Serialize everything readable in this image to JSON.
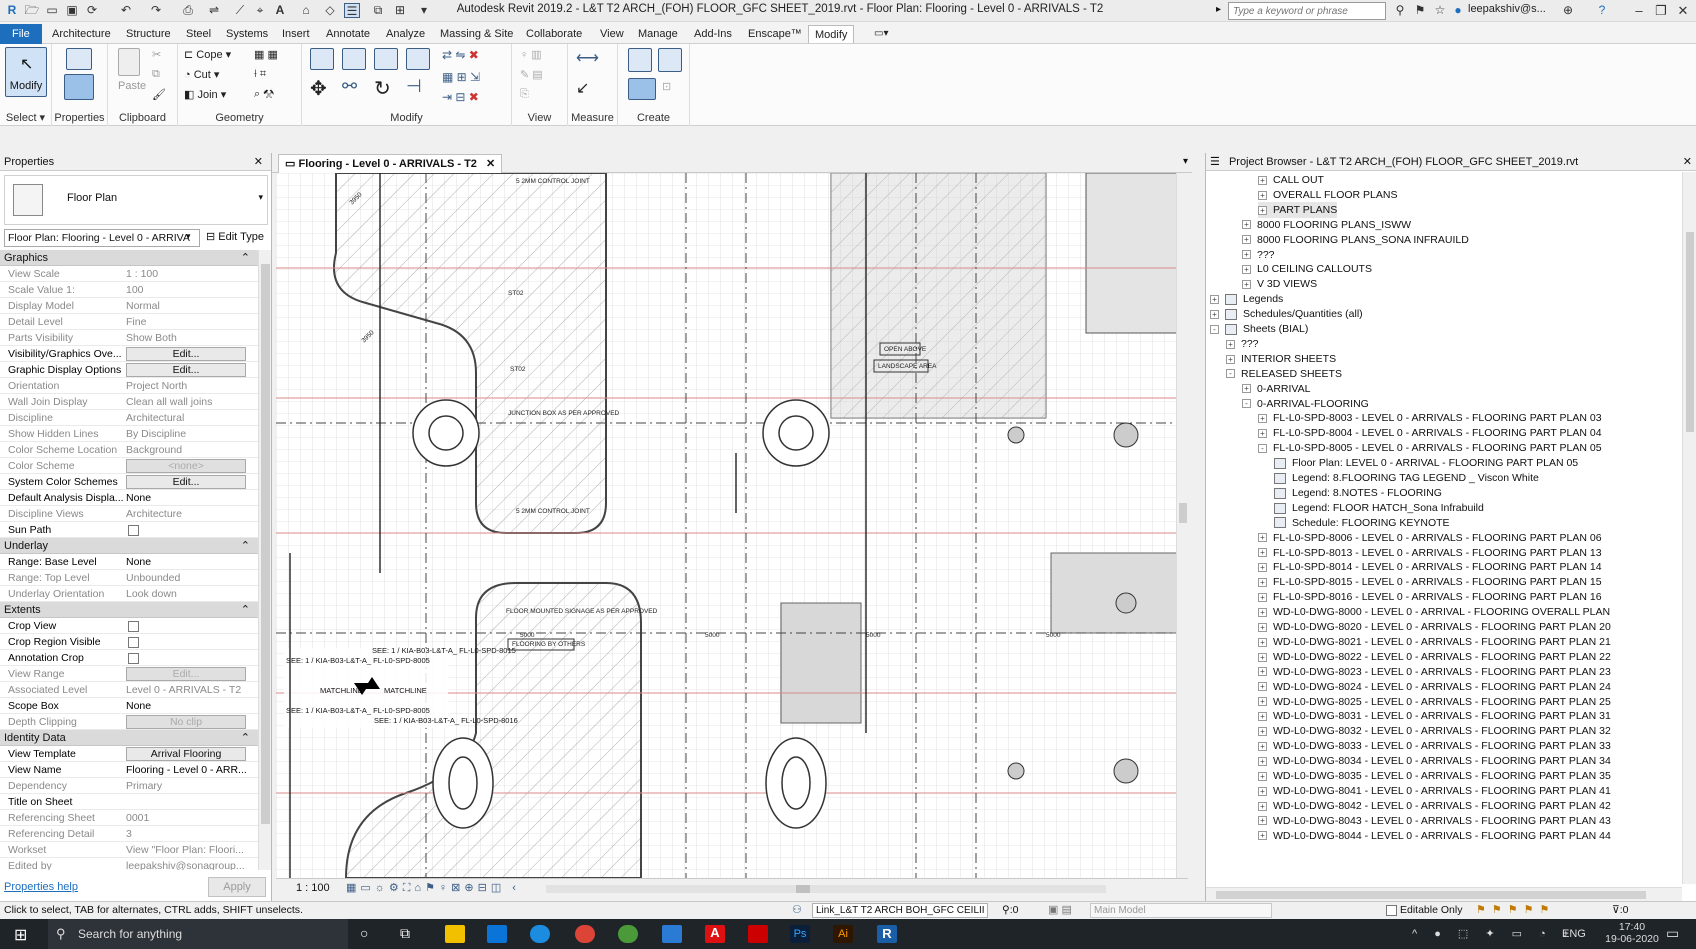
{
  "app": {
    "title": "Autodesk Revit 2019.2 - L&T T2 ARCH_(FOH) FLOOR_GFC SHEET_2019.rvt - Floor Plan: Flooring - Level 0 - ARRIVALS - T2",
    "search_placeholder": "Type a keyword or phrase",
    "user": "leepakshiv@s...",
    "logo": "R"
  },
  "ribbon_tabs": [
    "File",
    "Architecture",
    "Structure",
    "Steel",
    "Systems",
    "Insert",
    "Annotate",
    "Analyze",
    "Massing & Site",
    "Collaborate",
    "View",
    "Manage",
    "Add-Ins",
    "Enscape™",
    "Modify"
  ],
  "ribbon": {
    "modify_label": "Modify",
    "select_label": "Select",
    "properties_label": "Properties",
    "clipboard_label": "Clipboard",
    "paste_label": "Paste",
    "geometry_label": "Geometry",
    "cope_label": "Cope",
    "cut_label": "Cut",
    "join_label": "Join",
    "modify_panel_label": "Modify",
    "view_label": "View",
    "measure_label": "Measure",
    "create_label": "Create"
  },
  "properties": {
    "header": "Properties",
    "type_name": "Floor Plan",
    "selector": "Floor Plan: Flooring - Level 0 - ARRIVA",
    "edit_type": "Edit Type",
    "help_link": "Properties help",
    "apply": "Apply",
    "groups": {
      "graphics": "Graphics",
      "underlay": "Underlay",
      "extents": "Extents",
      "identity": "Identity Data"
    },
    "rows": [
      {
        "k": "View Scale",
        "v": "1 : 100",
        "dim": true
      },
      {
        "k": "Scale Value    1:",
        "v": "100",
        "dim": true
      },
      {
        "k": "Display Model",
        "v": "Normal",
        "dim": true
      },
      {
        "k": "Detail Level",
        "v": "Fine",
        "dim": true
      },
      {
        "k": "Parts Visibility",
        "v": "Show Both",
        "dim": true
      },
      {
        "k": "Visibility/Graphics Ove...",
        "v": "Edit...",
        "btn": true
      },
      {
        "k": "Graphic Display Options",
        "v": "Edit...",
        "btn": true
      },
      {
        "k": "Orientation",
        "v": "Project North",
        "dim": true
      },
      {
        "k": "Wall Join Display",
        "v": "Clean all wall joins",
        "dim": true
      },
      {
        "k": "Discipline",
        "v": "Architectural",
        "dim": true
      },
      {
        "k": "Show Hidden Lines",
        "v": "By Discipline",
        "dim": true
      },
      {
        "k": "Color Scheme Location",
        "v": "Background",
        "dim": true
      },
      {
        "k": "Color Scheme",
        "v": "<none>",
        "dim": true,
        "btn": true
      },
      {
        "k": "System Color Schemes",
        "v": "Edit...",
        "btn": true
      },
      {
        "k": "Default Analysis Displa...",
        "v": "None"
      },
      {
        "k": "Discipline Views",
        "v": "Architecture",
        "dim": true
      },
      {
        "k": "Sun Path",
        "v": "",
        "cb": true
      }
    ],
    "underlay_rows": [
      {
        "k": "Range: Base Level",
        "v": "None"
      },
      {
        "k": "Range: Top Level",
        "v": "Unbounded",
        "dim": true
      },
      {
        "k": "Underlay Orientation",
        "v": "Look down",
        "dim": true
      }
    ],
    "extents_rows": [
      {
        "k": "Crop View",
        "v": "",
        "cb": true
      },
      {
        "k": "Crop Region Visible",
        "v": "",
        "cb": true
      },
      {
        "k": "Annotation Crop",
        "v": "",
        "cb": true
      },
      {
        "k": "View Range",
        "v": "Edit...",
        "dim": true,
        "btn": true
      },
      {
        "k": "Associated Level",
        "v": "Level 0 - ARRIVALS - T2",
        "dim": true
      },
      {
        "k": "Scope Box",
        "v": "None"
      },
      {
        "k": "Depth Clipping",
        "v": "No clip",
        "dim": true,
        "btn": true
      }
    ],
    "identity_rows": [
      {
        "k": "View Template",
        "v": "Arrival Flooring",
        "btn": true
      },
      {
        "k": "View Name",
        "v": "Flooring - Level 0 - ARR..."
      },
      {
        "k": "Dependency",
        "v": "Primary",
        "dim": true
      },
      {
        "k": "Title on Sheet",
        "v": ""
      },
      {
        "k": "Referencing Sheet",
        "v": "0001",
        "dim": true
      },
      {
        "k": "Referencing Detail",
        "v": "3",
        "dim": true
      },
      {
        "k": "Workset",
        "v": "View \"Floor Plan: Floori...",
        "dim": true
      },
      {
        "k": "Edited by",
        "v": "leepakshiv@sonagroup...",
        "dim": true
      }
    ]
  },
  "view": {
    "tab_title": "Flooring - Level 0 - ARRIVALS - T2",
    "scale": "1 : 100",
    "annotations": {
      "control_joint_top": "5 2MM CONTROL JOINT",
      "control_joint_mid": "5 2MM CONTROL JOINT",
      "junction_box": "JUNCTION BOX AS PER APPROVED",
      "signage": "FLOOR MOUNTED SIGNAGE AS PER APPROVED",
      "flooring_by_others": "FLOORING BY OTHERS",
      "open_above": "OPEN ABOVE",
      "landscape": "LANDSCAPE AREA",
      "dim_1": "5000",
      "dim_2": "5000",
      "dim_3": "5000",
      "dim_4": "5000",
      "st_1": "ST02",
      "st_2": "ST02",
      "angle_1": "3950",
      "angle_2": "3950",
      "see_left": "SEE: 1 / KIA-B03-L&T-A_ FL-L0-SPD-8005",
      "see_right": "SEE: 1 / KIA-B03-L&T-A_ FL-L0-SPD-8015",
      "matchline": "MATCHLINE",
      "see_left_b": "SEE: 1 / KIA-B03-L&T-A_ FL-L0-SPD-8005",
      "see_right_b": "SEE: 1 / KIA-B03-L&T-A_ FL-L0-SPD-8016"
    }
  },
  "project_browser": {
    "header": "Project Browser - L&T T2 ARCH_(FOH) FLOOR_GFC SHEET_2019.rvt",
    "nodes": [
      {
        "label": "CALL OUT",
        "indent": 3,
        "exp": "+"
      },
      {
        "label": "OVERALL FLOOR PLANS",
        "indent": 3,
        "exp": "+"
      },
      {
        "label": "PART PLANS",
        "indent": 3,
        "exp": "+",
        "selected": true
      },
      {
        "label": "8000 FLOORING PLANS_ISWW",
        "indent": 2,
        "exp": "+"
      },
      {
        "label": "8000 FLOORING PLANS_SONA INFRAUILD",
        "indent": 2,
        "exp": "+"
      },
      {
        "label": "???",
        "indent": 2,
        "exp": "+"
      },
      {
        "label": "L0 CEILING CALLOUTS",
        "indent": 2,
        "exp": "+"
      },
      {
        "label": "V 3D VIEWS",
        "indent": 2,
        "exp": "+"
      },
      {
        "label": "Legends",
        "indent": 0,
        "exp": "+",
        "icon": true
      },
      {
        "label": "Schedules/Quantities (all)",
        "indent": 0,
        "exp": "+",
        "icon": true
      },
      {
        "label": "Sheets (BIAL)",
        "indent": 0,
        "exp": "-",
        "icon": true
      },
      {
        "label": "???",
        "indent": 1,
        "exp": "+"
      },
      {
        "label": "INTERIOR SHEETS",
        "indent": 1,
        "exp": "+"
      },
      {
        "label": "RELEASED SHEETS",
        "indent": 1,
        "exp": "-"
      },
      {
        "label": "0-ARRIVAL",
        "indent": 2,
        "exp": "+"
      },
      {
        "label": "0-ARRIVAL-FLOORING",
        "indent": 2,
        "exp": "-"
      },
      {
        "label": "FL-L0-SPD-8003 - LEVEL 0 - ARRIVALS - FLOORING PART PLAN 03",
        "indent": 3,
        "exp": "+"
      },
      {
        "label": "FL-L0-SPD-8004 - LEVEL 0 - ARRIVALS - FLOORING PART PLAN 04",
        "indent": 3,
        "exp": "+"
      },
      {
        "label": "FL-L0-SPD-8005 - LEVEL 0 - ARRIVALS - FLOORING PART PLAN 05",
        "indent": 3,
        "exp": "-"
      },
      {
        "label": "Floor Plan: LEVEL 0 - ARRIVAL - FLOORING PART PLAN 05",
        "indent": 4,
        "icon": true
      },
      {
        "label": "Legend: 8.FLOORING TAG LEGEND _ Viscon White",
        "indent": 4,
        "icon": true
      },
      {
        "label": "Legend: 8.NOTES - FLOORING",
        "indent": 4,
        "icon": true
      },
      {
        "label": "Legend: FLOOR HATCH_Sona Infrabuild",
        "indent": 4,
        "icon": true
      },
      {
        "label": "Schedule: FLOORING KEYNOTE",
        "indent": 4,
        "icon": true
      },
      {
        "label": "FL-L0-SPD-8006 - LEVEL 0 - ARRIVALS - FLOORING PART PLAN 06",
        "indent": 3,
        "exp": "+"
      },
      {
        "label": "FL-L0-SPD-8013 - LEVEL 0 - ARRIVALS - FLOORING PART PLAN 13",
        "indent": 3,
        "exp": "+"
      },
      {
        "label": "FL-L0-SPD-8014 - LEVEL 0 - ARRIVALS - FLOORING PART PLAN 14",
        "indent": 3,
        "exp": "+"
      },
      {
        "label": "FL-L0-SPD-8015 - LEVEL 0 - ARRIVALS - FLOORING PART PLAN 15",
        "indent": 3,
        "exp": "+"
      },
      {
        "label": "FL-L0-SPD-8016 - LEVEL 0 - ARRIVALS - FLOORING PART PLAN 16",
        "indent": 3,
        "exp": "+"
      },
      {
        "label": "WD-L0-DWG-8000 - LEVEL 0 - ARRIVAL - FLOORING OVERALL PLAN",
        "indent": 3,
        "exp": "+"
      },
      {
        "label": "WD-L0-DWG-8020 - LEVEL 0 - ARRIVALS - FLOORING PART PLAN 20",
        "indent": 3,
        "exp": "+"
      },
      {
        "label": "WD-L0-DWG-8021 - LEVEL 0 - ARRIVALS - FLOORING PART PLAN 21",
        "indent": 3,
        "exp": "+"
      },
      {
        "label": "WD-L0-DWG-8022 - LEVEL 0 - ARRIVALS - FLOORING PART PLAN 22",
        "indent": 3,
        "exp": "+"
      },
      {
        "label": "WD-L0-DWG-8023 - LEVEL 0 - ARRIVALS - FLOORING PART PLAN 23",
        "indent": 3,
        "exp": "+"
      },
      {
        "label": "WD-L0-DWG-8024 - LEVEL 0 - ARRIVALS - FLOORING PART PLAN 24",
        "indent": 3,
        "exp": "+"
      },
      {
        "label": "WD-L0-DWG-8025 - LEVEL 0 - ARRIVALS - FLOORING PART PLAN 25",
        "indent": 3,
        "exp": "+"
      },
      {
        "label": "WD-L0-DWG-8031 - LEVEL 0 - ARRIVALS - FLOORING  PART PLAN 31",
        "indent": 3,
        "exp": "+"
      },
      {
        "label": "WD-L0-DWG-8032 - LEVEL 0 - ARRIVALS - FLOORING PART PLAN 32",
        "indent": 3,
        "exp": "+"
      },
      {
        "label": "WD-L0-DWG-8033 - LEVEL 0 - ARRIVALS - FLOORING PART PLAN 33",
        "indent": 3,
        "exp": "+"
      },
      {
        "label": "WD-L0-DWG-8034 - LEVEL 0 - ARRIVALS - FLOORING PART PLAN 34",
        "indent": 3,
        "exp": "+"
      },
      {
        "label": "WD-L0-DWG-8035 - LEVEL 0 - ARRIVALS - FLOORING PART PLAN 35",
        "indent": 3,
        "exp": "+"
      },
      {
        "label": "WD-L0-DWG-8041 - LEVEL 0 - ARRIVALS - FLOORING PART PLAN 41",
        "indent": 3,
        "exp": "+"
      },
      {
        "label": "WD-L0-DWG-8042 - LEVEL 0 - ARRIVALS - FLOORING PART PLAN 42",
        "indent": 3,
        "exp": "+"
      },
      {
        "label": "WD-L0-DWG-8043 - LEVEL 0 - ARRIVALS - FLOORING PART PLAN 43",
        "indent": 3,
        "exp": "+"
      },
      {
        "label": "WD-L0-DWG-8044 - LEVEL 0 - ARRIVALS - FLOORING PART PLAN 44",
        "indent": 3,
        "exp": "+"
      }
    ]
  },
  "status": {
    "hint": "Click to select, TAB for alternates, CTRL adds, SHIFT unselects.",
    "link": "Link_L&T T2 ARCH BOH_GFC CEILII",
    "zero": ":0",
    "model": "Main Model",
    "editable": "Editable Only",
    "filter_count": ":0"
  },
  "taskbar": {
    "search": "Search for anything",
    "lang": "ENG",
    "time": "17:40",
    "date": "19-06-2020"
  },
  "colors": {
    "file_tab": "#1d6fbe",
    "taskbar": "#1f2429",
    "grid_red": "#d98a8a"
  }
}
